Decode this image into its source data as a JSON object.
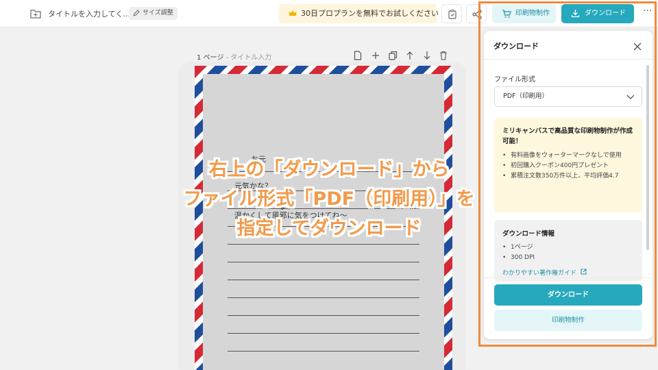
{
  "topbar": {
    "doc_title": "タイトルを入力してく...",
    "size_label": "サイズ調整",
    "promo_text": "30日プロプランを無料でお試しください",
    "print_label": "印刷物制作",
    "download_label": "ダウンロード",
    "more": "···"
  },
  "page": {
    "label": "1 ページ",
    "label_sub": " - タイトル入力",
    "handwriting": [
      "お元",
      "元気かな？",
      "なっ",
      "温かくして風邪に気をつけてね〜"
    ]
  },
  "panel": {
    "title": "ダウンロード",
    "format_label": "ファイル形式",
    "format_value": "PDF（印刷用）",
    "promo_title": "ミリキャンバスで高品質な印刷物制作が作成可能！",
    "promo_items": [
      "有料画像をウォーターマークなしで使用",
      "初回購入クーポン400円プレゼント",
      "累積注文数350万件以上、平均評価4.7"
    ],
    "info_title": "ダウンロード情報",
    "info_items": [
      "1ページ",
      "300 DPI"
    ],
    "guide_link": "わかりやすい著作権ガイド",
    "download_button": "ダウンロード",
    "print_button": "印刷物制作"
  },
  "caption": {
    "line1": "右上の「ダウンロード」から",
    "line2": "ファイル形式「PDF（印刷用）」を",
    "line3": "指定してダウンロード"
  },
  "colors": {
    "accent": "#26a9bd",
    "highlight": "#f08a3a",
    "caption": "#f29a4a"
  }
}
